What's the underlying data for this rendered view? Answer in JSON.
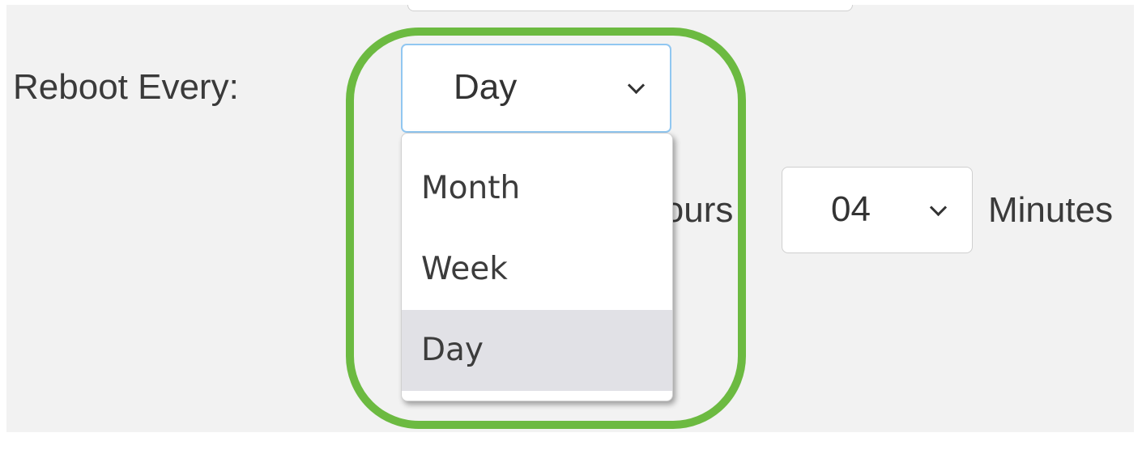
{
  "reboot": {
    "label": "Reboot Every:",
    "selected": "Day",
    "options": [
      "Month",
      "Week",
      "Day"
    ]
  },
  "time": {
    "hours_label": "Hours",
    "minutes_value": "04",
    "minutes_label": "Minutes"
  },
  "icons": {
    "select_arrow": "chevron-down-icon"
  },
  "colors": {
    "highlight": "#6cba41",
    "focus_border": "#91c7f1",
    "selected_option": "#e1e1e6"
  }
}
